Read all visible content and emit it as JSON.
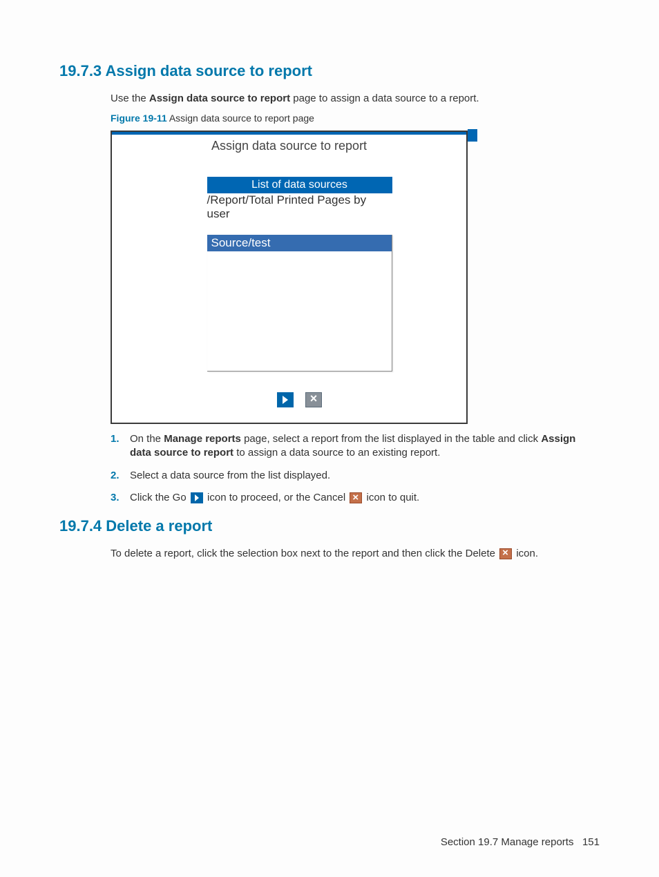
{
  "section1": {
    "heading": "19.7.3 Assign data source to report",
    "intro_pre": "Use the ",
    "intro_bold": "Assign data source to report",
    "intro_post": " page to assign a data source to a report.",
    "fig_num": "Figure 19-11",
    "fig_title": "  Assign data source to report page"
  },
  "screenshot": {
    "title": "Assign data source to report",
    "list_header": "List of data sources",
    "list_sub": "/Report/Total Printed Pages by user",
    "selected": "Source/test",
    "go_name": "go-icon",
    "cancel_name": "cancel-icon"
  },
  "steps": [
    {
      "n": "1.",
      "pre": "On the ",
      "b1": "Manage reports",
      "mid": " page, select a report from the list displayed in the table and click ",
      "b2": "Assign data source to report",
      "post": " to assign a data source to an existing report."
    },
    {
      "n": "2.",
      "text": "Select a data source from the list displayed."
    },
    {
      "n": "3.",
      "pre": "Click the Go ",
      "mid": " icon to proceed, or the Cancel ",
      "post": " icon to quit."
    }
  ],
  "section2": {
    "heading": "19.7.4 Delete a report",
    "text_pre": "To delete a report, click the selection box next to the report and then click the Delete ",
    "text_post": " icon."
  },
  "footer": {
    "section": "Section 19.7  Manage reports",
    "page": "151"
  }
}
